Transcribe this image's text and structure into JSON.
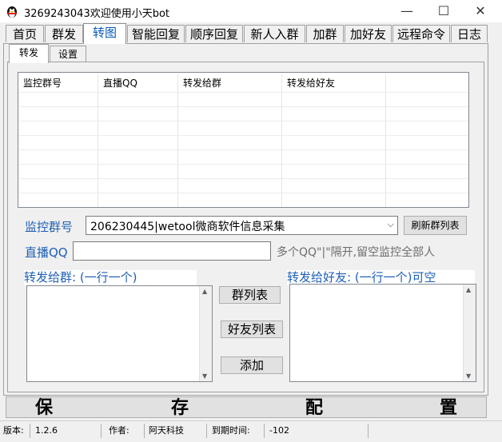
{
  "window": {
    "title": "3269243043欢迎使用小天bot",
    "minimize": "—",
    "maximize": "☐",
    "close": "✕"
  },
  "top_tabs": [
    "首页",
    "群发",
    "转图",
    "智能回复",
    "顺序回复",
    "新人入群",
    "加群",
    "加好友",
    "远程命令",
    "日志"
  ],
  "active_top_tab": "转图",
  "sub_tabs": [
    "转发",
    "设置"
  ],
  "active_sub_tab": "转发",
  "list": {
    "columns": [
      "监控群号",
      "直播QQ",
      "转发给群",
      "转发给好友"
    ],
    "rows": []
  },
  "form": {
    "monitor_group_label": "监控群号",
    "monitor_group_value": "206230445|wetool微商软件信息采集",
    "refresh_button": "刷新群列表",
    "live_qq_label": "直播QQ",
    "live_qq_value": "",
    "live_qq_hint": "多个QQ\"|\"隔开,留空监控全部人",
    "forward_groups_label": "转发给群:  (一行一个)",
    "forward_friends_label": "转发给好友:  (一行一个)可空",
    "group_list_button": "群列表",
    "friend_list_button": "好友列表",
    "add_button": "添加",
    "save_chars": [
      "保",
      "存",
      "配",
      "置"
    ]
  },
  "status": {
    "version_label": "版本:",
    "version": "1.2.6",
    "author_label": "作者:",
    "author": "阿天科技",
    "expiry_label": "到期时间:",
    "expiry": "-102"
  },
  "colors": {
    "accent": "#1e5fb4",
    "panel": "#f0f0f0"
  },
  "icons": {
    "app": "penguin-icon",
    "combo_arrow": "chevron-down-icon"
  }
}
